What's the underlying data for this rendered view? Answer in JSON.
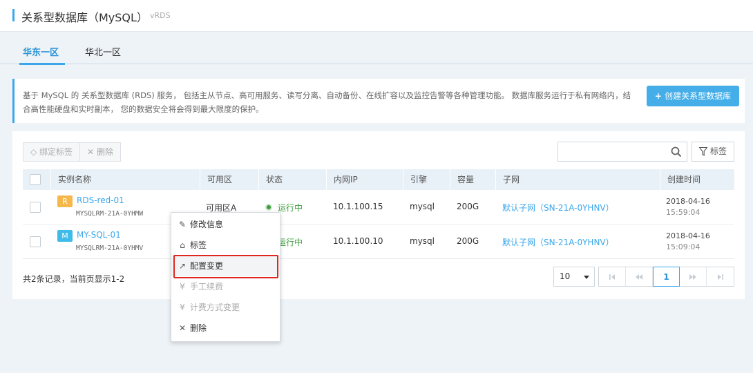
{
  "header": {
    "title": "关系型数据库（MySQL）",
    "subtitle": "vRDS"
  },
  "tabs": [
    {
      "label": "华东一区"
    },
    {
      "label": "华北一区"
    }
  ],
  "info": {
    "description": "基于 MySQL 的 关系型数据库 (RDS) 服务， 包括主从节点、高可用服务、读写分离、自动备份、在线扩容以及监控告警等各种管理功能。 数据库服务运行于私有网络内，结合高性能硬盘和实时副本， 您的数据安全将会得到最大限度的保护。",
    "create_button": "创建关系型数据库"
  },
  "toolbar": {
    "bind_tag": "绑定标签",
    "delete": "删除",
    "search_placeholder": "",
    "tag_filter": "标签"
  },
  "table": {
    "columns": [
      "实例名称",
      "可用区",
      "状态",
      "内网IP",
      "引擎",
      "容量",
      "子网",
      "创建时间"
    ],
    "rows": [
      {
        "badge": "R",
        "badge_color": "#f7b84b",
        "name": "RDS-red-01",
        "id": "MYSQLRM-21A-0YHMW",
        "zone": "可用区A",
        "status": "运行中",
        "ip": "10.1.100.15",
        "engine": "mysql",
        "capacity": "200G",
        "subnet": "默认子网（SN-21A-0YHNV）",
        "date": "2018-04-16",
        "time": "15:59:04"
      },
      {
        "badge": "M",
        "badge_color": "#3ebbe8",
        "name": "MY-SQL-01",
        "id": "MYSQLRM-21A-0YHMV",
        "zone": "",
        "status": "运行中",
        "ip": "10.1.100.10",
        "engine": "mysql",
        "capacity": "200G",
        "subnet": "默认子网（SN-21A-0YHNV）",
        "date": "2018-04-16",
        "time": "15:09:04"
      }
    ]
  },
  "footer": {
    "summary": "共2条记录，当前页显示1-2",
    "page_size": "10",
    "current_page": "1"
  },
  "context_menu": {
    "items": [
      {
        "label": "修改信息",
        "icon": "pencil-icon",
        "glyph": "✎",
        "disabled": false
      },
      {
        "label": "标签",
        "icon": "tag-icon",
        "glyph": "⌂",
        "disabled": false
      },
      {
        "label": "配置变更",
        "icon": "trend-icon",
        "glyph": "↗",
        "disabled": false,
        "highlighted": true
      },
      {
        "label": "手工续费",
        "icon": "yen-icon",
        "glyph": "¥",
        "disabled": true
      },
      {
        "label": "计费方式变更",
        "icon": "yen-icon",
        "glyph": "¥",
        "disabled": true
      },
      {
        "label": "删除",
        "icon": "close-icon",
        "glyph": "✕",
        "disabled": false
      }
    ]
  },
  "colors": {
    "accent": "#3aa7ea",
    "running": "#3b9d3b",
    "highlight_border": "#e0261f"
  }
}
